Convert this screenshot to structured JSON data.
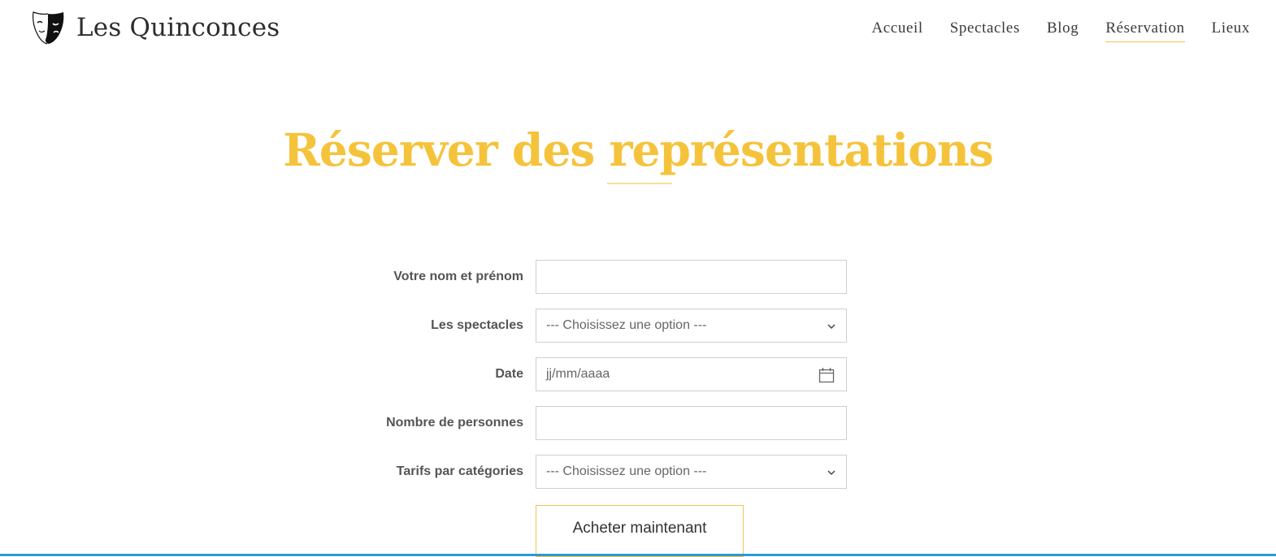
{
  "site": {
    "name": "Les Quinconces",
    "logo_icon": "theatre-mask-icon"
  },
  "nav": {
    "items": [
      {
        "label": "Accueil",
        "active": false
      },
      {
        "label": "Spectacles",
        "active": false
      },
      {
        "label": "Blog",
        "active": false
      },
      {
        "label": "Réservation",
        "active": true
      },
      {
        "label": "Lieux",
        "active": false
      }
    ]
  },
  "page": {
    "title": "Réserver des représentations"
  },
  "colors": {
    "accent": "#f5c33b",
    "text": "#333333",
    "border": "#cfcfcf"
  },
  "form": {
    "name": {
      "label": "Votre nom et prénom",
      "value": "",
      "placeholder": ""
    },
    "shows": {
      "label": "Les spectacles",
      "selected": "--- Choisissez une option ---"
    },
    "date": {
      "label": "Date",
      "placeholder": "jj/mm/aaaa"
    },
    "people": {
      "label": "Nombre de personnes",
      "value": "",
      "placeholder": ""
    },
    "rates": {
      "label": "Tarifs par catégories",
      "selected": "--- Choisissez une option ---"
    },
    "submit_label": "Acheter maintenant"
  }
}
